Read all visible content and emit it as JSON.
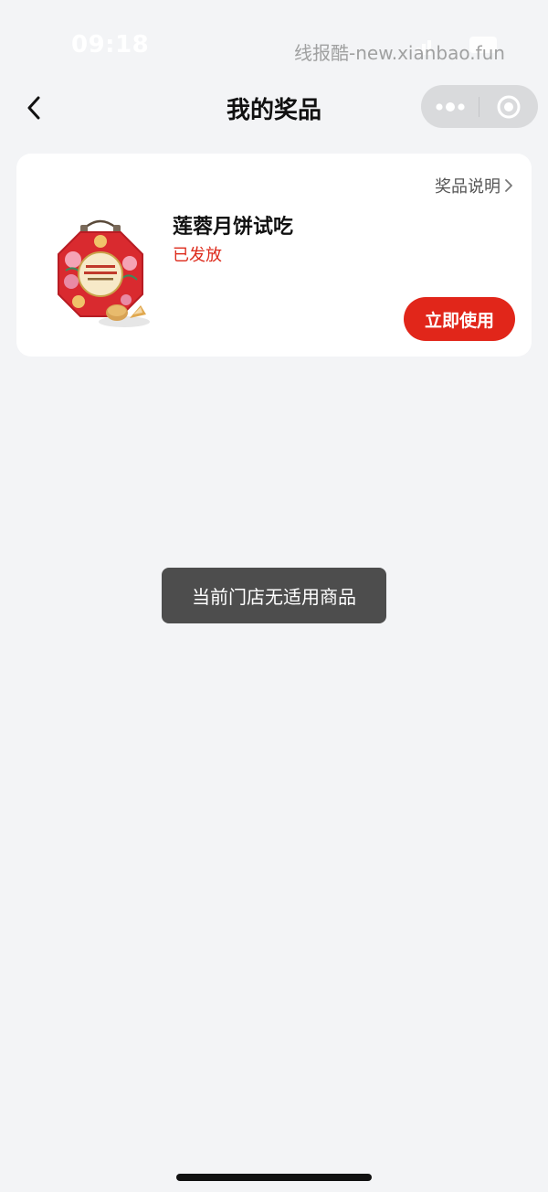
{
  "status_bar": {
    "time": "09:18"
  },
  "watermark": "线报酷-new.xianbao.fun",
  "nav": {
    "title": "我的奖品",
    "back_icon": "chevron-left-icon",
    "more_icon": "more-dots-icon",
    "close_icon": "target-circle-icon"
  },
  "prize": {
    "desc_link": "奖品说明",
    "desc_icon": "chevron-right-icon",
    "name": "莲蓉月饼试吃",
    "status": "已发放",
    "use_button": "立即使用",
    "image_icon": "mooncake-gift-box-image",
    "status_color": "#dd2a1b",
    "button_color": "#e1261a"
  },
  "toast": {
    "message": "当前门店无适用商品"
  }
}
